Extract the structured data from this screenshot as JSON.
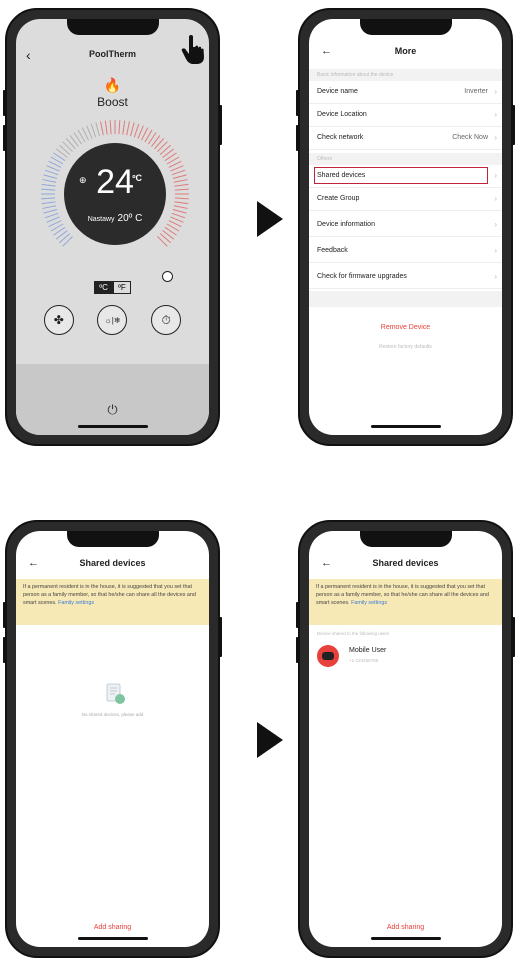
{
  "phone1": {
    "back_glyph": "‹",
    "title": "PoolTherm",
    "edit_glyph": "✎",
    "flame_glyph": "🔥",
    "mode": "Boost",
    "dial_icon_glyph": "⊕",
    "current_temp": "24",
    "temp_unit": "ºC",
    "set_label": "Nastawy",
    "set_value": "20º C",
    "unit_c": "ºC",
    "unit_f": "ºF",
    "btn_fan": "✤",
    "btn_mode": "☼|❄",
    "btn_timer": "⏱",
    "power_glyph": "⏻"
  },
  "phone2": {
    "back_glyph": "←",
    "title": "More",
    "section1": "Basic information about the device",
    "rows1": [
      {
        "label": "Device name",
        "value": "Inverter"
      },
      {
        "label": "Device Location",
        "value": ""
      },
      {
        "label": "Check network",
        "value": "Check Now"
      }
    ],
    "section2": "Others",
    "rows2": [
      {
        "label": "Shared devices",
        "value": ""
      },
      {
        "label": "Create Group",
        "value": ""
      },
      {
        "label": "Device information",
        "value": ""
      },
      {
        "label": "Feedback",
        "value": ""
      },
      {
        "label": "Check for firmware upgrades",
        "value": ""
      }
    ],
    "chevron": "›",
    "remove": "Remove Device",
    "restore": "Restore factory defaults"
  },
  "phone3": {
    "back_glyph": "←",
    "title": "Shared devices",
    "notice": "If a permanent resident is in the house, it is suggested that you set that person as a family member, so that he/she can share all the devices and smart scenes.",
    "notice_link": "Family settings",
    "empty": "No shared devices, please add",
    "add": "Add sharing"
  },
  "phone4": {
    "back_glyph": "←",
    "title": "Shared devices",
    "notice": "If a permanent resident is in the house, it is suggested that you set that person as a family member, so that he/she can share all the devices and smart scenes.",
    "notice_link": "Family settings",
    "hint": "Device shared to the following users",
    "user_name": "Mobile User",
    "user_account": "+1-123456789",
    "add": "Add sharing"
  },
  "colors": {
    "accent": "#e8403a",
    "highlight": "#c0243c",
    "notice_bg": "#f7e9b6",
    "link": "#3a7bd5"
  }
}
